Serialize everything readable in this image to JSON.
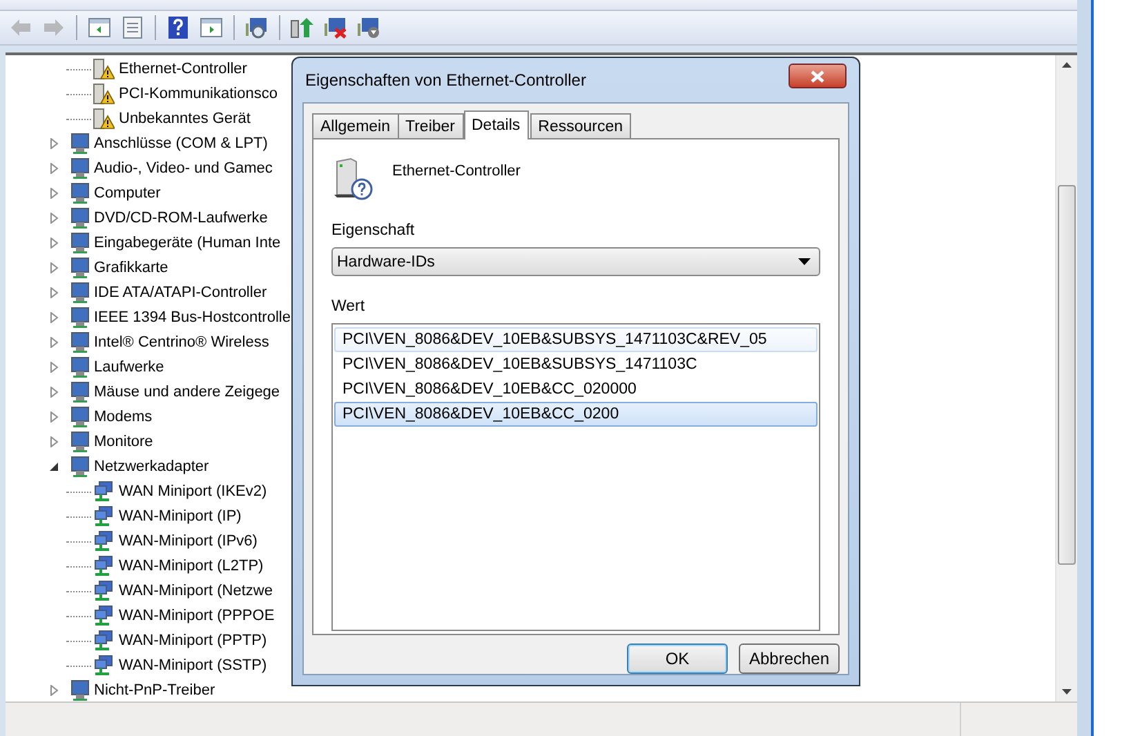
{
  "toolbar": [
    {
      "kind": "back",
      "disabled": true
    },
    {
      "kind": "forward",
      "disabled": true
    },
    {
      "kind": "tree",
      "disabled": false
    },
    {
      "kind": "props",
      "disabled": false
    },
    {
      "kind": "help",
      "disabled": false
    },
    {
      "kind": "pane",
      "disabled": false
    },
    {
      "kind": "scan",
      "disabled": false
    },
    {
      "kind": "update",
      "disabled": false
    },
    {
      "kind": "uninstall",
      "disabled": false
    },
    {
      "kind": "disable",
      "disabled": false
    }
  ],
  "tree": {
    "continued_children": [
      {
        "label": "Ethernet-Controller",
        "warning": true
      },
      {
        "label": "PCI-Kommunikationsco",
        "warning": true
      },
      {
        "label": "Unbekanntes Gerät",
        "warning": true
      }
    ],
    "items": [
      {
        "label": "Anschlüsse (COM & LPT)",
        "expanded": false
      },
      {
        "label": "Audio-, Video- und Gamec",
        "expanded": false
      },
      {
        "label": "Computer",
        "expanded": false
      },
      {
        "label": "DVD/CD-ROM-Laufwerke",
        "expanded": false
      },
      {
        "label": "Eingabegeräte (Human Inte",
        "expanded": false
      },
      {
        "label": "Grafikkarte",
        "expanded": false
      },
      {
        "label": "IDE ATA/ATAPI-Controller",
        "expanded": false
      },
      {
        "label": "IEEE 1394 Bus-Hostcontrolle",
        "expanded": false
      },
      {
        "label": "Intel® Centrino® Wireless",
        "expanded": false
      },
      {
        "label": "Laufwerke",
        "expanded": false
      },
      {
        "label": "Mäuse und andere Zeigege",
        "expanded": false
      },
      {
        "label": "Modems",
        "expanded": false
      },
      {
        "label": "Monitore",
        "expanded": false
      },
      {
        "label": "Netzwerkadapter",
        "expanded": true,
        "children": [
          {
            "label": "WAN Miniport (IKEv2)",
            "warning": false
          },
          {
            "label": "WAN-Miniport (IP)",
            "warning": false
          },
          {
            "label": "WAN-Miniport (IPv6)",
            "warning": false
          },
          {
            "label": "WAN-Miniport (L2TP)",
            "warning": false
          },
          {
            "label": "WAN-Miniport (Netzwe",
            "warning": false
          },
          {
            "label": "WAN-Miniport (PPPOE",
            "warning": false
          },
          {
            "label": "WAN-Miniport (PPTP)",
            "warning": false
          },
          {
            "label": "WAN-Miniport (SSTP)",
            "warning": false
          }
        ]
      },
      {
        "label": "Nicht-PnP-Treiber",
        "expanded": false
      }
    ]
  },
  "dialog": {
    "title": "Eigenschaften von Ethernet-Controller",
    "tabs": [
      {
        "label": "Allgemein",
        "selected": false
      },
      {
        "label": "Treiber",
        "selected": false
      },
      {
        "label": "Details",
        "selected": true
      },
      {
        "label": "Ressourcen",
        "selected": false
      }
    ],
    "device_name": "Ethernet-Controller",
    "property_label": "Eigenschaft",
    "property_value": "Hardware-IDs",
    "value_label": "Wert",
    "values": [
      {
        "text": "PCI\\VEN_8086&DEV_10EB&SUBSYS_1471103C&REV_05",
        "selected": false,
        "hovered": true
      },
      {
        "text": "PCI\\VEN_8086&DEV_10EB&SUBSYS_1471103C",
        "selected": false,
        "hovered": false
      },
      {
        "text": "PCI\\VEN_8086&DEV_10EB&CC_020000",
        "selected": false,
        "hovered": false
      },
      {
        "text": "PCI\\VEN_8086&DEV_10EB&CC_0200",
        "selected": true,
        "hovered": false
      }
    ],
    "buttons": [
      {
        "label": "OK",
        "default": true
      },
      {
        "label": "Abbrechen",
        "default": false
      }
    ]
  }
}
